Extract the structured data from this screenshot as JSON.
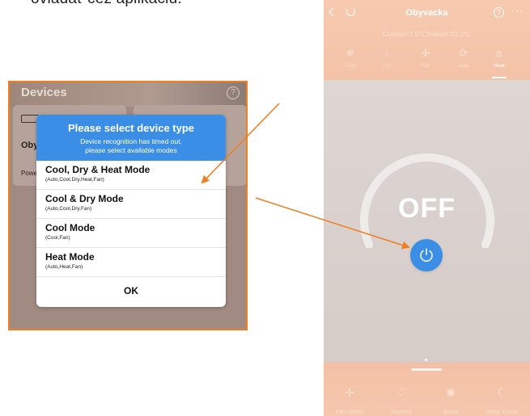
{
  "caption_text": "ovládať cez aplikáciu.",
  "left_screen": {
    "header_title": "Devices",
    "help_glyph": "?",
    "card_label": "Oby",
    "card_sub": "Powe",
    "dialog": {
      "title": "Please select device type",
      "subtitle_line1": "Device recognition has timed out.",
      "subtitle_line2": "please select available modes",
      "options": [
        {
          "title": "Cool, Dry & Heat Mode",
          "sub": "(Auto,Cool,Dry,Heat,Fan)"
        },
        {
          "title": "Cool & Dry Mode",
          "sub": "(Auto,Cool,Dry,Fan)"
        },
        {
          "title": "Cool Mode",
          "sub": "(Cool,Fan)"
        },
        {
          "title": "Heat Mode",
          "sub": "(Auto,Heat,Fan)"
        }
      ],
      "ok_label": "OK"
    },
    "accent_color": "#3a8ee6"
  },
  "right_screen": {
    "title": "Obyvacka",
    "help_glyph": "?",
    "more_glyph": "···",
    "temps": "Outdoor:7.0°C/Indoor:23.0°C",
    "modes": [
      {
        "label": "Cool",
        "icon": "snowflake-icon"
      },
      {
        "label": "Dry",
        "icon": "droplet-icon"
      },
      {
        "label": "Fan",
        "icon": "fan-icon"
      },
      {
        "label": "Auto",
        "icon": "cycle-icon"
      },
      {
        "label": "Heat",
        "icon": "sun-icon",
        "active": true
      }
    ],
    "power_state": "OFF",
    "bottom_items": [
      {
        "label": "Fan Speed",
        "icon": "fan-speed-icon"
      },
      {
        "label": "Favorite",
        "icon": "heart-icon"
      },
      {
        "label": "Boost",
        "icon": "boost-icon"
      },
      {
        "label": "Sleep Curve",
        "icon": "moon-icon"
      }
    ],
    "accent_color": "#3a8ee6"
  },
  "annotation_color": "#ef7d22"
}
